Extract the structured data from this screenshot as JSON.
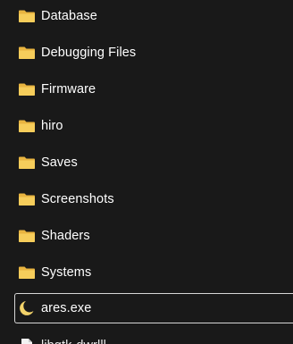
{
  "items": [
    {
      "name": "Database",
      "type": "folder",
      "icon": "folder-icon"
    },
    {
      "name": "Debugging Files",
      "type": "folder",
      "icon": "folder-icon"
    },
    {
      "name": "Firmware",
      "type": "folder",
      "icon": "folder-icon"
    },
    {
      "name": "hiro",
      "type": "folder",
      "icon": "folder-icon"
    },
    {
      "name": "Saves",
      "type": "folder",
      "icon": "folder-icon"
    },
    {
      "name": "Screenshots",
      "type": "folder",
      "icon": "folder-icon"
    },
    {
      "name": "Shaders",
      "type": "folder",
      "icon": "folder-icon"
    },
    {
      "name": "Systems",
      "type": "folder",
      "icon": "folder-icon"
    },
    {
      "name": "ares.exe",
      "type": "application",
      "icon": "crescent-moon-icon",
      "selected": true
    },
    {
      "name": "libgtk-dwrlll",
      "type": "file",
      "icon": "file-icon",
      "partially_visible": true
    }
  ],
  "colors": {
    "background": "#191919",
    "text": "#ffffff",
    "folder": "#f1c34e",
    "selection_border": "#d6d6d6"
  }
}
